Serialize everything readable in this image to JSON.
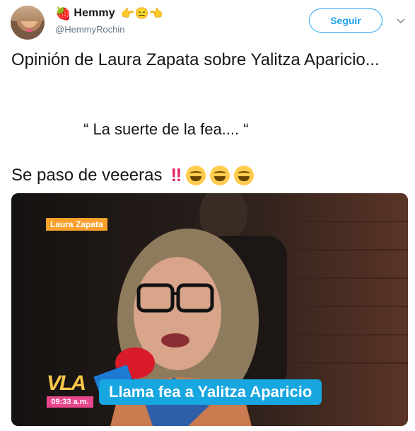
{
  "user": {
    "display_name": "Hemmy",
    "handle": "@HemmyRochin",
    "name_emojis": "👉😑👈",
    "strawberry": "🍓"
  },
  "follow_button": {
    "label": "Seguir"
  },
  "tweet": {
    "line1": "Opinión de Laura Zapata sobre Yalitza Aparicio...",
    "quote": "“ La suerte de la fea.... “",
    "line3": "Se paso de veeeras",
    "bangbang": "‼"
  },
  "video": {
    "name_tag": "Laura Zapata",
    "logo": "VLA",
    "time": "09:33 a.m.",
    "headline": "Llama fea a Yalitza Aparicio"
  },
  "colors": {
    "accent": "#1da1f2",
    "tag_orange": "#f7a02b",
    "headline_blue": "#17a6df",
    "time_pink": "#e9478d"
  }
}
